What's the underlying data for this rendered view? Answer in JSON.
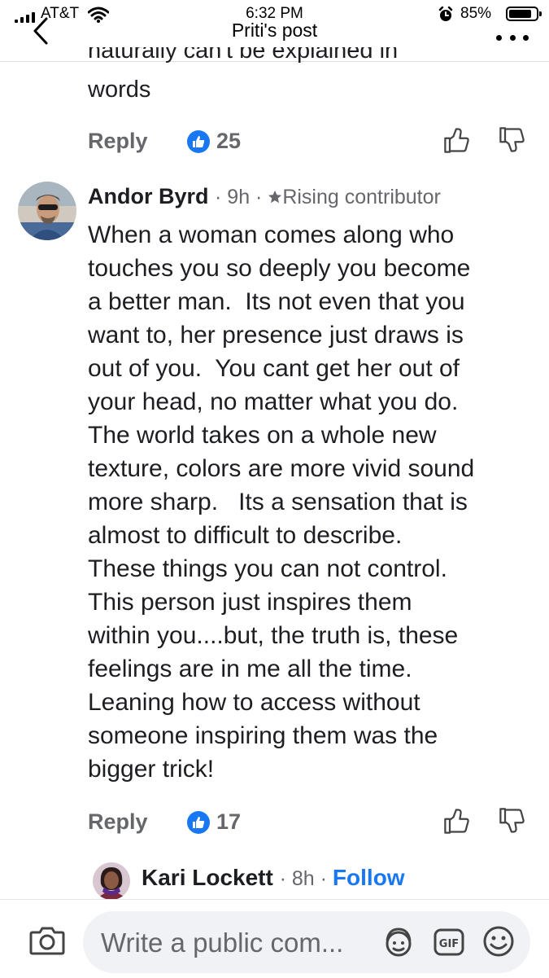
{
  "status_bar": {
    "carrier": "AT&T",
    "time": "6:32 PM",
    "battery": "85%",
    "battery_level": 0.85
  },
  "nav": {
    "title": "Priti's post"
  },
  "previous_comment": {
    "cut_line": "naturally can't be explained in",
    "last_line": "words",
    "reply_label": "Reply",
    "likes": "25"
  },
  "comment": {
    "author": "Andor Byrd",
    "time": "9h",
    "badge": "Rising contributor",
    "text_lines": [
      "When a woman comes along who",
      "touches you so deeply you become",
      "a better man.  Its not even that you",
      "want to, her presence just draws is",
      "out of you.  You cant get her out of",
      "your head, no matter what you do.",
      "The world takes on a whole new",
      "texture, colors are more vivid sound",
      "more sharp.   Its a sensation that is",
      "almost to difficult to describe.",
      "These things you can not control.",
      "This person just inspires them",
      "within you....but, the truth is, these",
      "feelings are in me all the time.",
      "Leaning how to access without",
      "someone inspiring them was the",
      "bigger trick!"
    ],
    "reply_label": "Reply",
    "likes": "17"
  },
  "next_comment": {
    "author": "Kari Lockett",
    "time": "8h",
    "follow_label": "Follow"
  },
  "composer": {
    "placeholder": "Write a public com..."
  },
  "colors": {
    "accent": "#1877f2",
    "secondary_text": "#65676b",
    "input_bg": "#f0f2f5"
  },
  "icons": [
    "back-chevron-icon",
    "more-icon",
    "like-icon",
    "thumbs-up-icon",
    "thumbs-down-icon",
    "star-icon",
    "camera-icon",
    "avatar-sticker-icon",
    "gif-icon",
    "emoji-icon"
  ]
}
